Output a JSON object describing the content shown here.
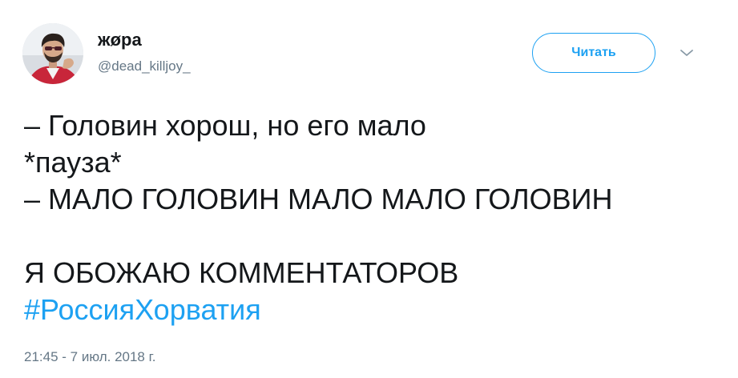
{
  "user": {
    "display_name": "жøра",
    "handle": "@dead_killjoy_",
    "avatar_icon": "user-avatar"
  },
  "actions": {
    "follow_label": "Читать",
    "more_icon": "chevron-down-icon",
    "accent_color": "#1da1f2"
  },
  "tweet": {
    "lines": [
      "– Головин хорош, но его мало",
      "*пауза*",
      "– МАЛО ГОЛОВИН МАЛО МАЛО ГОЛОВИН",
      "",
      "Я ОБОЖАЮ КОММЕНТАТОРОВ"
    ],
    "hashtag": "#РоссияХорватия",
    "timestamp": "21:45 - 7 июл. 2018 г."
  }
}
